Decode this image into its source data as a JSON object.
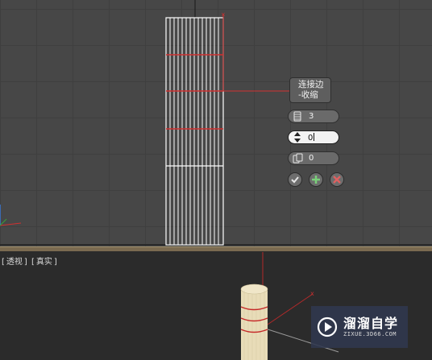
{
  "top_viewport": {},
  "caddy": {
    "title_line1": "连接边",
    "title_line2": "-收缩",
    "segments_value": "3",
    "pinch_value": "0",
    "slide_value": "0",
    "ok_icon": "checkmark-icon",
    "apply_icon": "plus-icon",
    "cancel_icon": "close-icon"
  },
  "bottom_viewport": {
    "label_view": "透视",
    "label_shading": "真实"
  },
  "watermark": {
    "title": "溜溜自学",
    "url": "ZIXUE.3D66.COM"
  },
  "colors": {
    "selected_edge": "#d03030",
    "wire": "#ffffff",
    "grid": "#3f3f3f",
    "viewport_bg": "#474747"
  }
}
